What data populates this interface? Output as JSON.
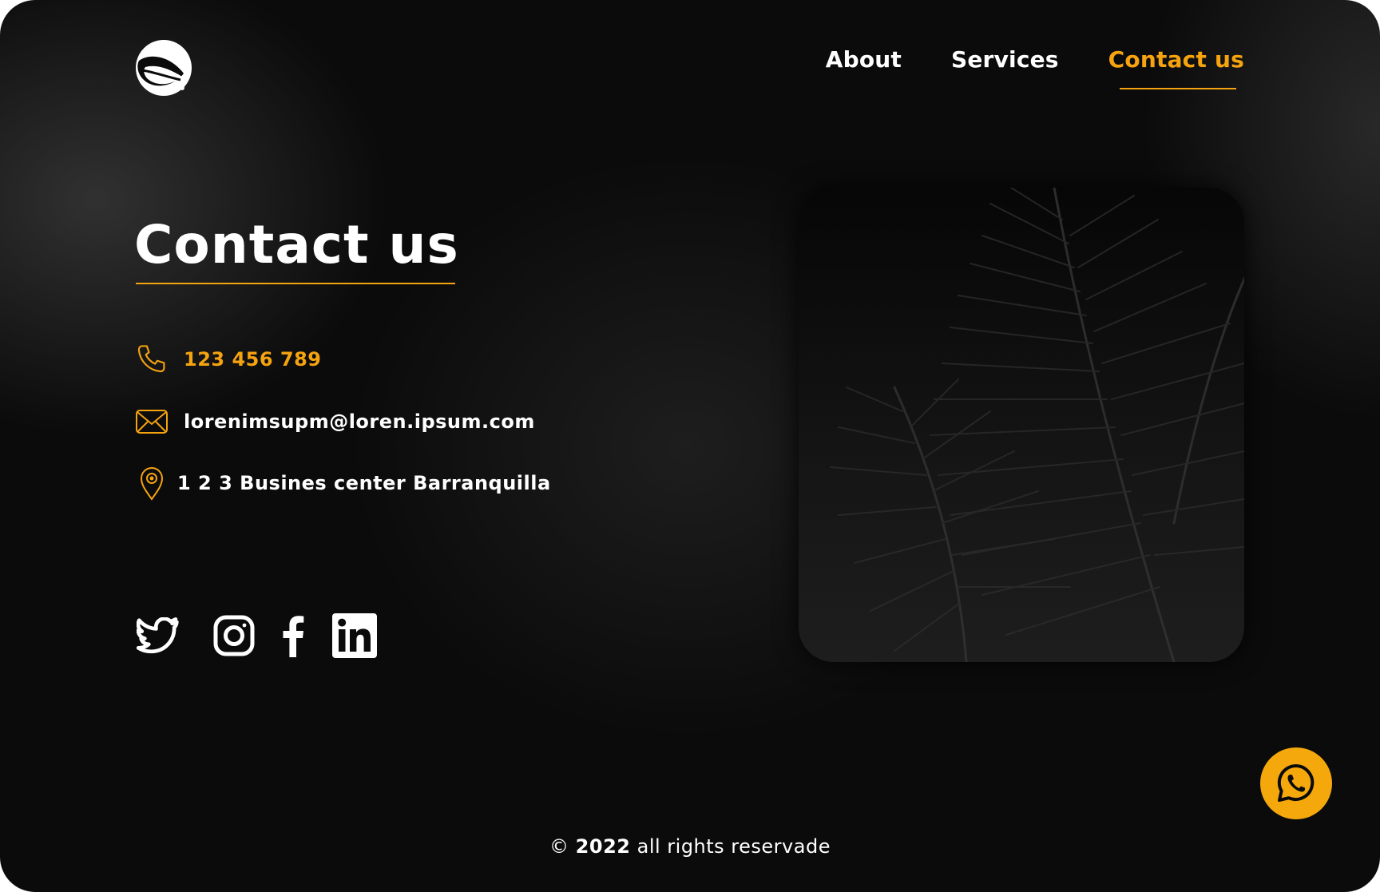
{
  "brand": {
    "logo_icon": "leaf-circle-logo",
    "accent_color": "#f5a30f",
    "background_color": "#0b0b0b"
  },
  "nav": {
    "items": [
      {
        "label": "About"
      },
      {
        "label": "Services"
      },
      {
        "label": "Contact us",
        "active": true
      }
    ]
  },
  "main": {
    "title": "Contact us",
    "phone": {
      "icon": "phone-icon",
      "value": "123 456 789"
    },
    "email": {
      "icon": "envelope-icon",
      "value": "lorenimsupm@loren.ipsum.com"
    },
    "address": {
      "icon": "location-pin-icon",
      "value": "1 2 3 Busines center Barranquilla"
    },
    "socials": [
      {
        "icon": "twitter-icon"
      },
      {
        "icon": "instagram-icon"
      },
      {
        "icon": "facebook-icon"
      },
      {
        "icon": "linkedin-icon"
      }
    ],
    "image": {
      "subject": "dark palm leaves photo"
    }
  },
  "footer": {
    "copyright_symbol": "©",
    "year": "2022",
    "text": "all rights reservade"
  },
  "whatsapp_button": {
    "icon": "whatsapp-icon"
  }
}
